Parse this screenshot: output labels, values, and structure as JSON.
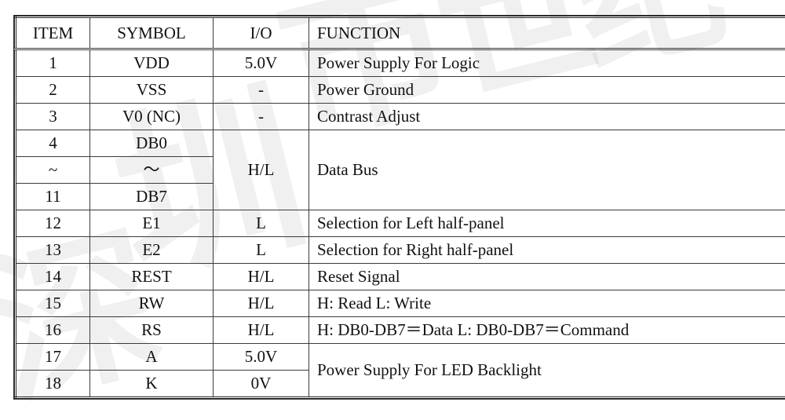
{
  "watermark": {
    "chars": [
      "深",
      "圳",
      "市",
      "世",
      "纪"
    ]
  },
  "table": {
    "columns": [
      {
        "key": "item",
        "label": "ITEM"
      },
      {
        "key": "symbol",
        "label": "SYMBOL"
      },
      {
        "key": "io",
        "label": "I/O"
      },
      {
        "key": "function",
        "label": "FUNCTION"
      }
    ],
    "rows": [
      {
        "item": "1",
        "symbol": "VDD",
        "io": "5.0V",
        "function": "Power Supply For Logic"
      },
      {
        "item": "2",
        "symbol": "VSS",
        "io": "-",
        "function": "Power Ground"
      },
      {
        "item": "3",
        "symbol": "V0 (NC)",
        "io": "-",
        "function": "Contrast Adjust"
      },
      {
        "item": "4",
        "symbol": "DB0",
        "io": "H/L",
        "function": "Data Bus"
      },
      {
        "item": "~",
        "symbol": "～",
        "io": "",
        "function": ""
      },
      {
        "item": "11",
        "symbol": "DB7",
        "io": "",
        "function": ""
      },
      {
        "item": "12",
        "symbol": "E1",
        "io": "L",
        "function": "Selection for Left half-panel"
      },
      {
        "item": "13",
        "symbol": "E2",
        "io": "L",
        "function": "Selection for Right half-panel"
      },
      {
        "item": "14",
        "symbol": "REST",
        "io": "H/L",
        "function": "Reset Signal"
      },
      {
        "item": "15",
        "symbol": "RW",
        "io": "H/L",
        "function": "H:  Read   L:  Write"
      },
      {
        "item": "16",
        "symbol": "RS",
        "io": "H/L",
        "function": "H:  DB0-DB7＝Data    L:  DB0-DB7＝Command"
      },
      {
        "item": "17",
        "symbol": "A",
        "io": "5.0V",
        "function": "Power Supply For LED Backlight"
      },
      {
        "item": "18",
        "symbol": "K",
        "io": "0V",
        "function": ""
      }
    ],
    "merged_cells": {
      "data_bus_io": "H/L",
      "data_bus_function": "Data Bus",
      "backlight_function": "Power Supply For LED Backlight"
    }
  },
  "colors": {
    "text": "#111111",
    "border": "#3b3b3b",
    "frame": "#2a2a2a",
    "background": "#ffffff",
    "watermark": "rgba(120,120,120,0.115)"
  }
}
